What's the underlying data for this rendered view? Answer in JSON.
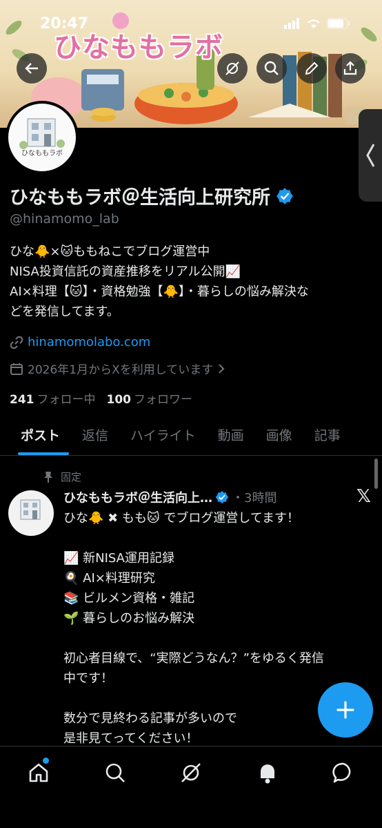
{
  "status_bar": {
    "time": "20:47"
  },
  "banner": {
    "title": "ひなももラボ"
  },
  "avatar": {
    "label": "ひなももラボ"
  },
  "profile": {
    "name": "ひなももラボ＠生活向上研究所",
    "handle": "@hinamomo_lab",
    "bio_lines": [
      "ひな🐥×🐱ももねこでブログ運営中",
      "NISA投資信託の資産推移をリアル公開📈",
      "AI×料理【🐱】・資格勉強【🐥】・暮らしの悩み解決な",
      "どを発信してます。"
    ],
    "link": "hinamomolabo.com",
    "joined": "2026年1月からXを利用しています",
    "following_count": "241",
    "following_label": "フォロー中",
    "followers_count": "100",
    "followers_label": "フォロワー"
  },
  "tabs": [
    {
      "label": "ポスト",
      "active": true
    },
    {
      "label": "返信",
      "active": false
    },
    {
      "label": "ハイライト",
      "active": false
    },
    {
      "label": "動画",
      "active": false
    },
    {
      "label": "画像",
      "active": false
    },
    {
      "label": "記事",
      "active": false
    }
  ],
  "post": {
    "pinned_label": "固定",
    "author": "ひなももラボ＠生活向上…",
    "time": "・3時間",
    "body_lines": [
      "ひな🐥 ✖ もも🐱 でブログ運営してます！",
      "",
      "📈 新NISA運用記録",
      "🍳 AI×料理研究",
      "📚 ビルメン資格・雑記",
      "🌱 暮らしのお悩み解決",
      "",
      "初心者目線で、“実際どうなん？”をゆるく発信",
      "中です！",
      "",
      "数分で見終わる記事が多いので",
      "是非見てってください！"
    ]
  },
  "icons": {
    "back": "arrow-left-icon",
    "grok": "grok-icon",
    "search": "search-icon",
    "edit": "pencil-icon",
    "share": "share-icon"
  },
  "colors": {
    "accent": "#1d9bf0",
    "background": "#000000",
    "muted": "#71767b"
  }
}
